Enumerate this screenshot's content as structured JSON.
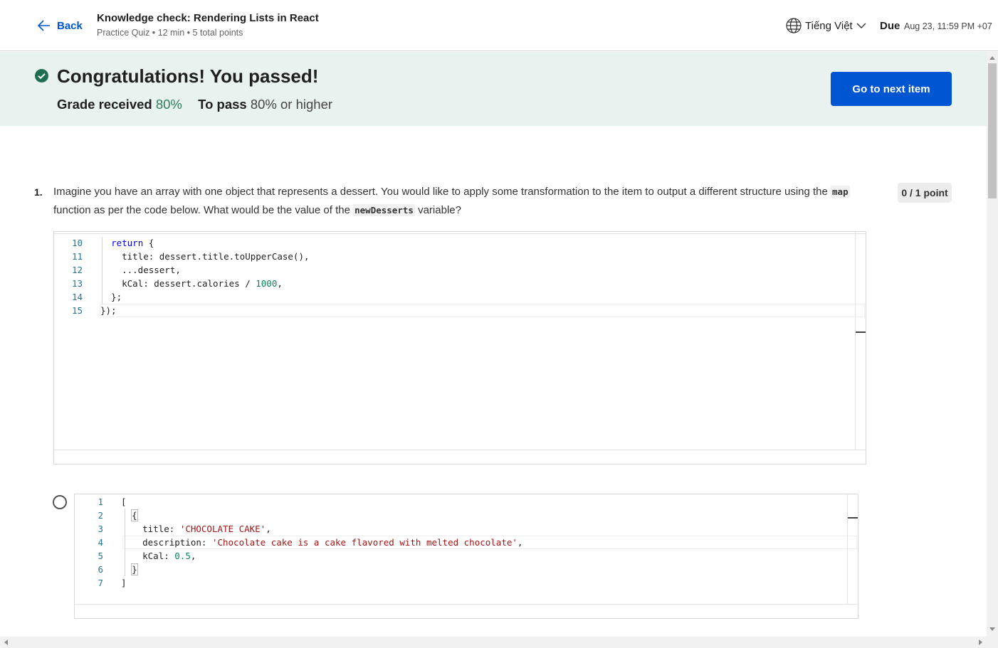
{
  "header": {
    "back_label": "Back",
    "title": "Knowledge check: Rendering Lists in React",
    "meta": "Practice Quiz • 12 min • 5 total points",
    "language": "Tiếng Việt",
    "due_label": "Due",
    "due_date": "Aug 23, 11:59 PM +07"
  },
  "banner": {
    "title": "Congratulations! You passed!",
    "grade_label": "Grade received",
    "grade_value": "80%",
    "pass_label": "To pass",
    "pass_value": "80% or higher",
    "next_button": "Go to next item"
  },
  "question": {
    "number": "1.",
    "text_part1": "Imagine you have an array with one object that represents a dessert. You would like to apply some transformation to the item to output a different structure using the",
    "code1": "map",
    "text_part2": "function as per the code below. What would be the value of the",
    "code2": "newDesserts",
    "text_part3": "variable?",
    "points": "0 / 1 point"
  },
  "question_code": {
    "lines": [
      {
        "n": "10",
        "html": "  <span class='kw'>return</span> {"
      },
      {
        "n": "11",
        "html": "    title: dessert.title.toUpperCase(),"
      },
      {
        "n": "12",
        "html": "    ...dessert,"
      },
      {
        "n": "13",
        "html": "    kCal: dessert.calories / <span class='num'>1000</span>,"
      },
      {
        "n": "14",
        "html": "  };"
      },
      {
        "n": "15",
        "html": "});"
      }
    ]
  },
  "option_code": {
    "lines": [
      {
        "n": "1",
        "html": "["
      },
      {
        "n": "2",
        "html": "  <span class='brkt'>{</span>"
      },
      {
        "n": "3",
        "html": "    title: <span class='str'>'CHOCOLATE CAKE'</span>,"
      },
      {
        "n": "4",
        "html": "    description: <span class='str'>'Chocolate cake is a cake flavored with melted chocolate'</span>,"
      },
      {
        "n": "5",
        "html": "    kCal: <span class='num'>0.5</span>,"
      },
      {
        "n": "6",
        "html": "  <span class='brkt'>}</span>"
      },
      {
        "n": "7",
        "html": "]"
      }
    ]
  }
}
